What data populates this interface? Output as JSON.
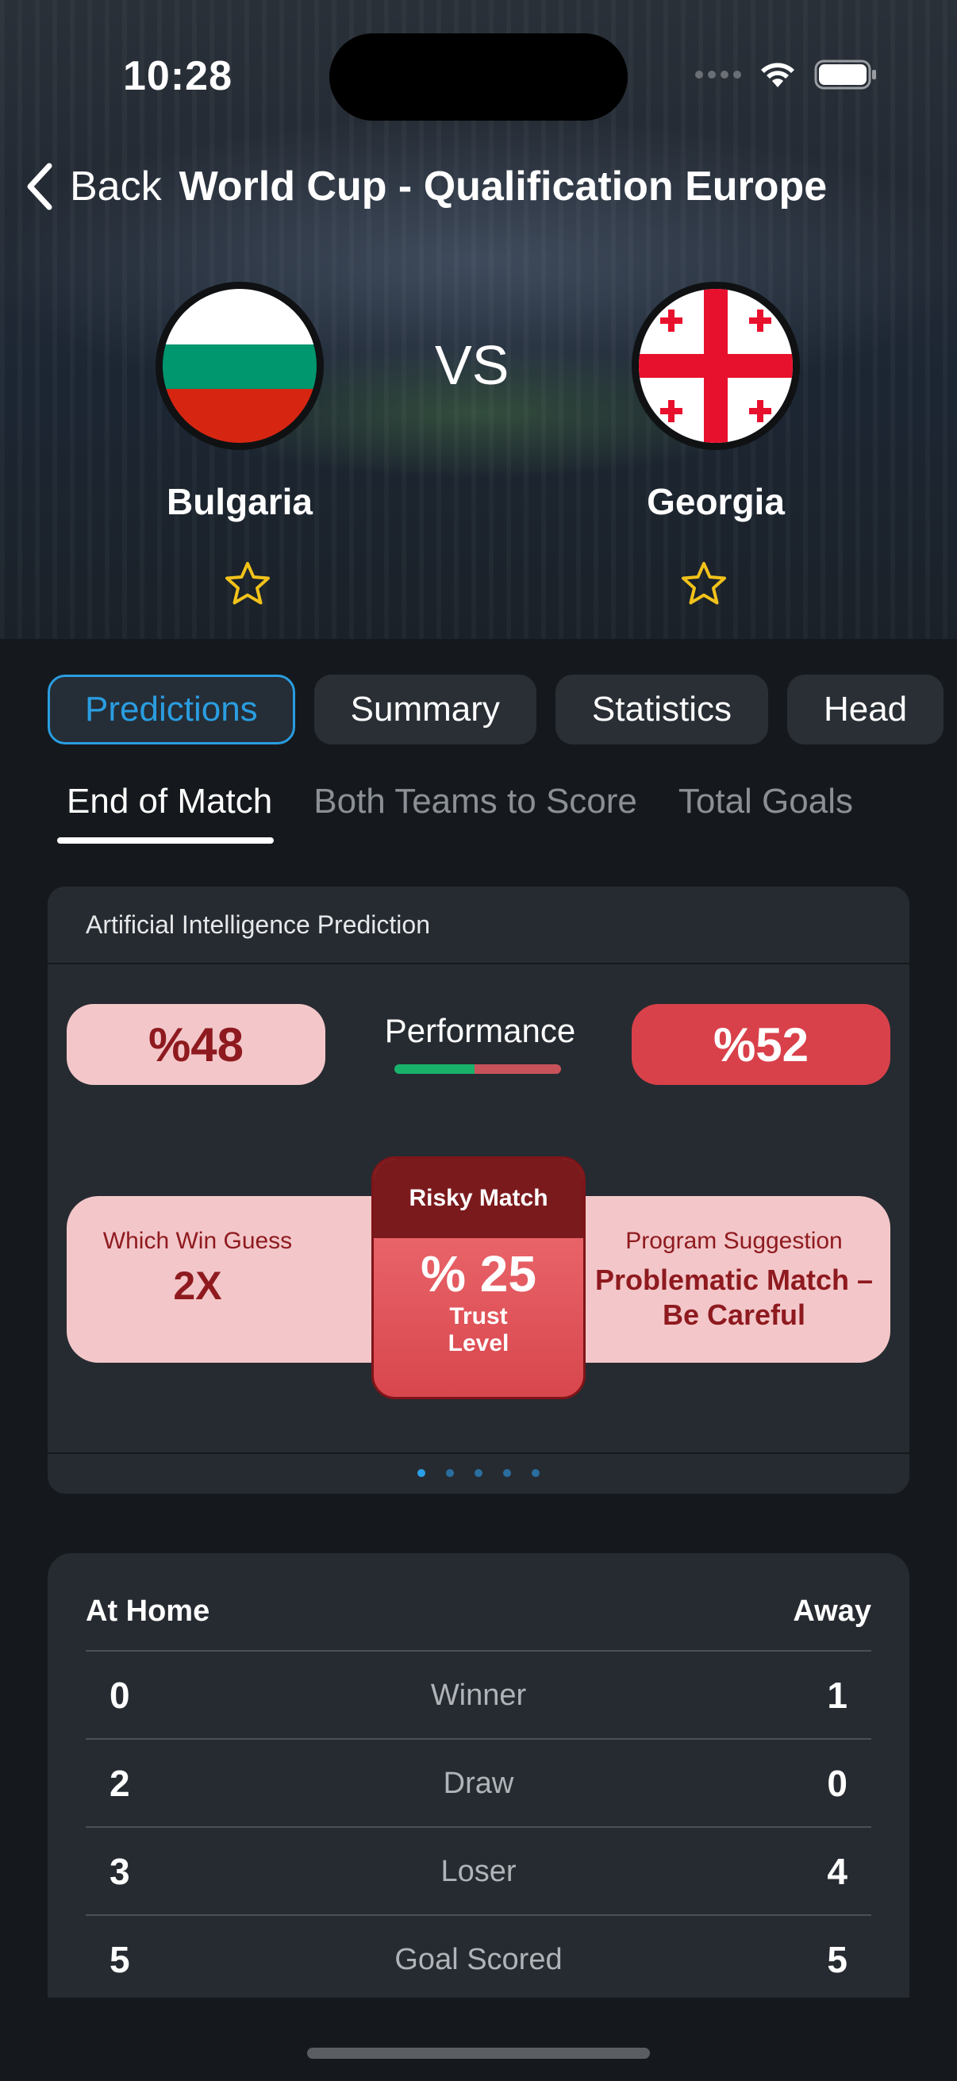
{
  "status_bar": {
    "time": "10:28"
  },
  "nav": {
    "back_label": "Back",
    "title": "World Cup - Qualification Europe"
  },
  "match": {
    "home": {
      "name": "Bulgaria",
      "flag": "bulgaria-flag"
    },
    "away": {
      "name": "Georgia",
      "flag": "georgia-flag"
    },
    "vs": "VS"
  },
  "tabs": [
    "Predictions",
    "Summary",
    "Statistics",
    "Head"
  ],
  "subtabs": [
    "End of Match",
    "Both Teams to Score",
    "Total Goals"
  ],
  "ai_card": {
    "title": "Artificial Intelligence Prediction",
    "home_percent": "%48",
    "away_percent": "%52",
    "performance_label": "Performance",
    "performance_home_fraction": 0.48,
    "which_win_label": "Which Win Guess",
    "which_win_value": "2X",
    "risk_title": "Risky Match",
    "risk_value": "% 25",
    "risk_sub": "Trust Level",
    "suggestion_label": "Program Suggestion",
    "suggestion_value": "Problematic Match – Be Careful",
    "page_count": 5,
    "active_page": 0
  },
  "stats": {
    "home_header": "At Home",
    "away_header": "Away",
    "rows": [
      {
        "home": "0",
        "label": "Winner",
        "away": "1"
      },
      {
        "home": "2",
        "label": "Draw",
        "away": "0"
      },
      {
        "home": "3",
        "label": "Loser",
        "away": "4"
      },
      {
        "home": "5",
        "label": "Goal Scored",
        "away": "5"
      }
    ]
  },
  "colors": {
    "accent": "#2a9de0",
    "home_pill": "#f3c7c9",
    "away_pill": "#d9414a",
    "risk_dark": "#7b1a1d",
    "perf_green": "#19b26b",
    "star": "#f2c21a"
  }
}
